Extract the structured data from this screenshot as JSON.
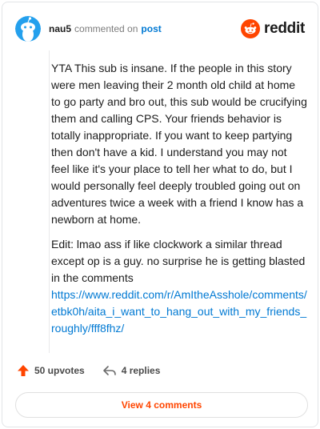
{
  "header": {
    "username": "nau5",
    "commented_on": "commented on",
    "post_link": "post",
    "brand": "reddit"
  },
  "comment": {
    "paragraph1": "YTA This sub is insane. If the people in this story were men leaving their 2 month old child at home to go party and bro out, this sub would be crucifying them and calling CPS. Your friends behavior is totally inappropriate. If you want to keep partying then don't have a kid. I understand you may not feel like it's your place to tell her what to do, but I would personally feel deeply troubled going out on adventures twice a week with a friend I know has a newborn at home.",
    "paragraph2": "Edit: lmao ass if like clockwork a similar thread except op is a guy. no surprise he is getting blasted in the comments",
    "link": "https://www.reddit.com/r/AmItheAsshole/comments/etbk0h/aita_i_want_to_hang_out_with_my_friends_roughly/fff8fhz/"
  },
  "actions": {
    "upvotes": "50 upvotes",
    "replies": "4 replies"
  },
  "view_comments": "View 4 comments",
  "colors": {
    "accent": "#ff4500",
    "link": "#0079d3"
  },
  "icons": [
    "snoo-avatar-icon",
    "reddit-logo-icon",
    "upvote-arrow-icon",
    "reply-icon"
  ]
}
